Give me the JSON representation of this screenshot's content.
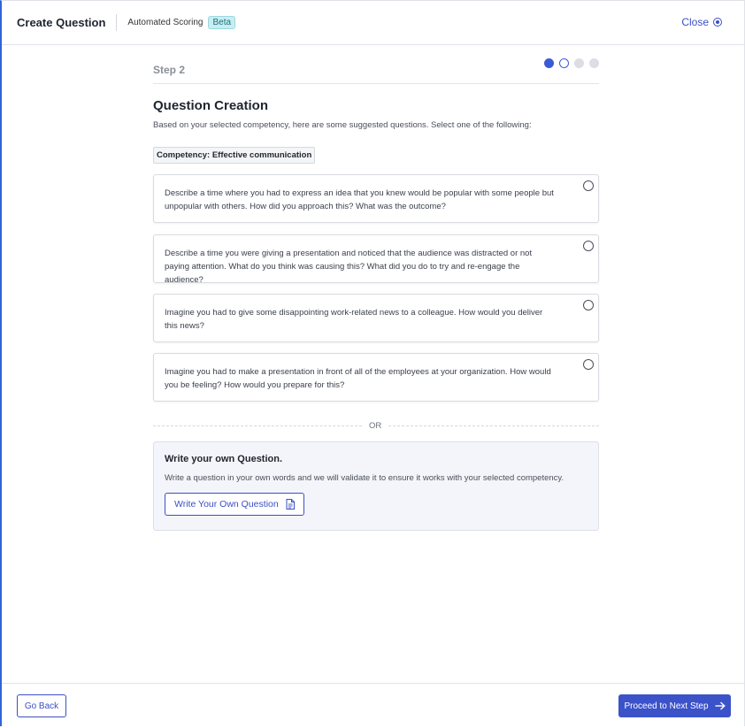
{
  "header": {
    "title": "Create Question",
    "subtitle": "Automated Scoring",
    "badge": "Beta",
    "close_label": "Close"
  },
  "step": {
    "label": "Step 2",
    "current_step": 2,
    "total_steps": 4
  },
  "main": {
    "title": "Question Creation",
    "description": "Based on your selected competency, here are some suggested questions. Select one of the following:",
    "competency_chip": "Competency: Effective communication",
    "questions": [
      {
        "text": "Describe a time where you had to express an idea that you knew would be popular with some people but unpopular with others. How did you approach this? What was the outcome?",
        "selected": false
      },
      {
        "text": "Describe a time you were giving a presentation and noticed that the audience was distracted or not paying attention. What do you think was causing this? What did you do to try and re-engage the audience?",
        "selected": false
      },
      {
        "text": "Imagine you had to give some disappointing work-related news to a colleague. How would you deliver this news?",
        "selected": false
      },
      {
        "text": "Imagine you had to make a presentation in front of all of the employees at your organization. How would you be feeling? How would you prepare for this?",
        "selected": false
      }
    ],
    "or_label": "OR",
    "own_question": {
      "title": "Write your own Question.",
      "description": "Write a question in your own words and we will validate it to ensure it works with your selected competency.",
      "button_label": "Write Your Own Question"
    }
  },
  "footer": {
    "back_label": "Go Back",
    "next_label": "Proceed to Next Step"
  },
  "colors": {
    "accent": "#3b52c9",
    "badge_bg": "#c9eef2",
    "left_border": "#2f64d6"
  },
  "icons": {
    "close": "circle-dot-icon",
    "write": "document-icon",
    "next": "arrow-right-icon"
  }
}
